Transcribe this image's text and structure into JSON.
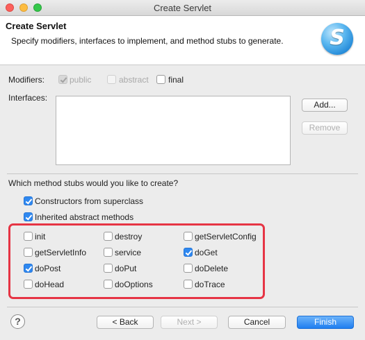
{
  "window": {
    "title": "Create Servlet"
  },
  "header": {
    "title": "Create Servlet",
    "description": "Specify modifiers, interfaces to implement, and method stubs to generate.",
    "logo_icon": "servlet-s-logo",
    "logo_letter": "S"
  },
  "modifiers": {
    "label": "Modifiers:",
    "options": [
      {
        "label": "public",
        "checked": true,
        "enabled": false
      },
      {
        "label": "abstract",
        "checked": false,
        "enabled": false
      },
      {
        "label": "final",
        "checked": false,
        "enabled": true
      }
    ]
  },
  "interfaces": {
    "label": "Interfaces:",
    "items": [],
    "add_label": "Add...",
    "remove_label": "Remove"
  },
  "stubs": {
    "question": "Which method stubs would you like to create?",
    "top_options": [
      {
        "label": "Constructors from superclass",
        "checked": true
      },
      {
        "label": "Inherited abstract methods",
        "checked": true
      }
    ],
    "grid": [
      {
        "label": "init",
        "checked": false
      },
      {
        "label": "destroy",
        "checked": false
      },
      {
        "label": "getServletConfig",
        "checked": false
      },
      {
        "label": "getServletInfo",
        "checked": false
      },
      {
        "label": "service",
        "checked": false
      },
      {
        "label": "doGet",
        "checked": true
      },
      {
        "label": "doPost",
        "checked": true
      },
      {
        "label": "doPut",
        "checked": false
      },
      {
        "label": "doDelete",
        "checked": false
      },
      {
        "label": "doHead",
        "checked": false
      },
      {
        "label": "doOptions",
        "checked": false
      },
      {
        "label": "doTrace",
        "checked": false
      }
    ],
    "highlight_color": "#e63444"
  },
  "footer": {
    "help_icon": "help-icon",
    "help_symbol": "?",
    "back_label": "< Back",
    "next_label": "Next >",
    "cancel_label": "Cancel",
    "finish_label": "Finish"
  },
  "colors": {
    "accent": "#2f88f0",
    "highlight": "#e63444"
  }
}
